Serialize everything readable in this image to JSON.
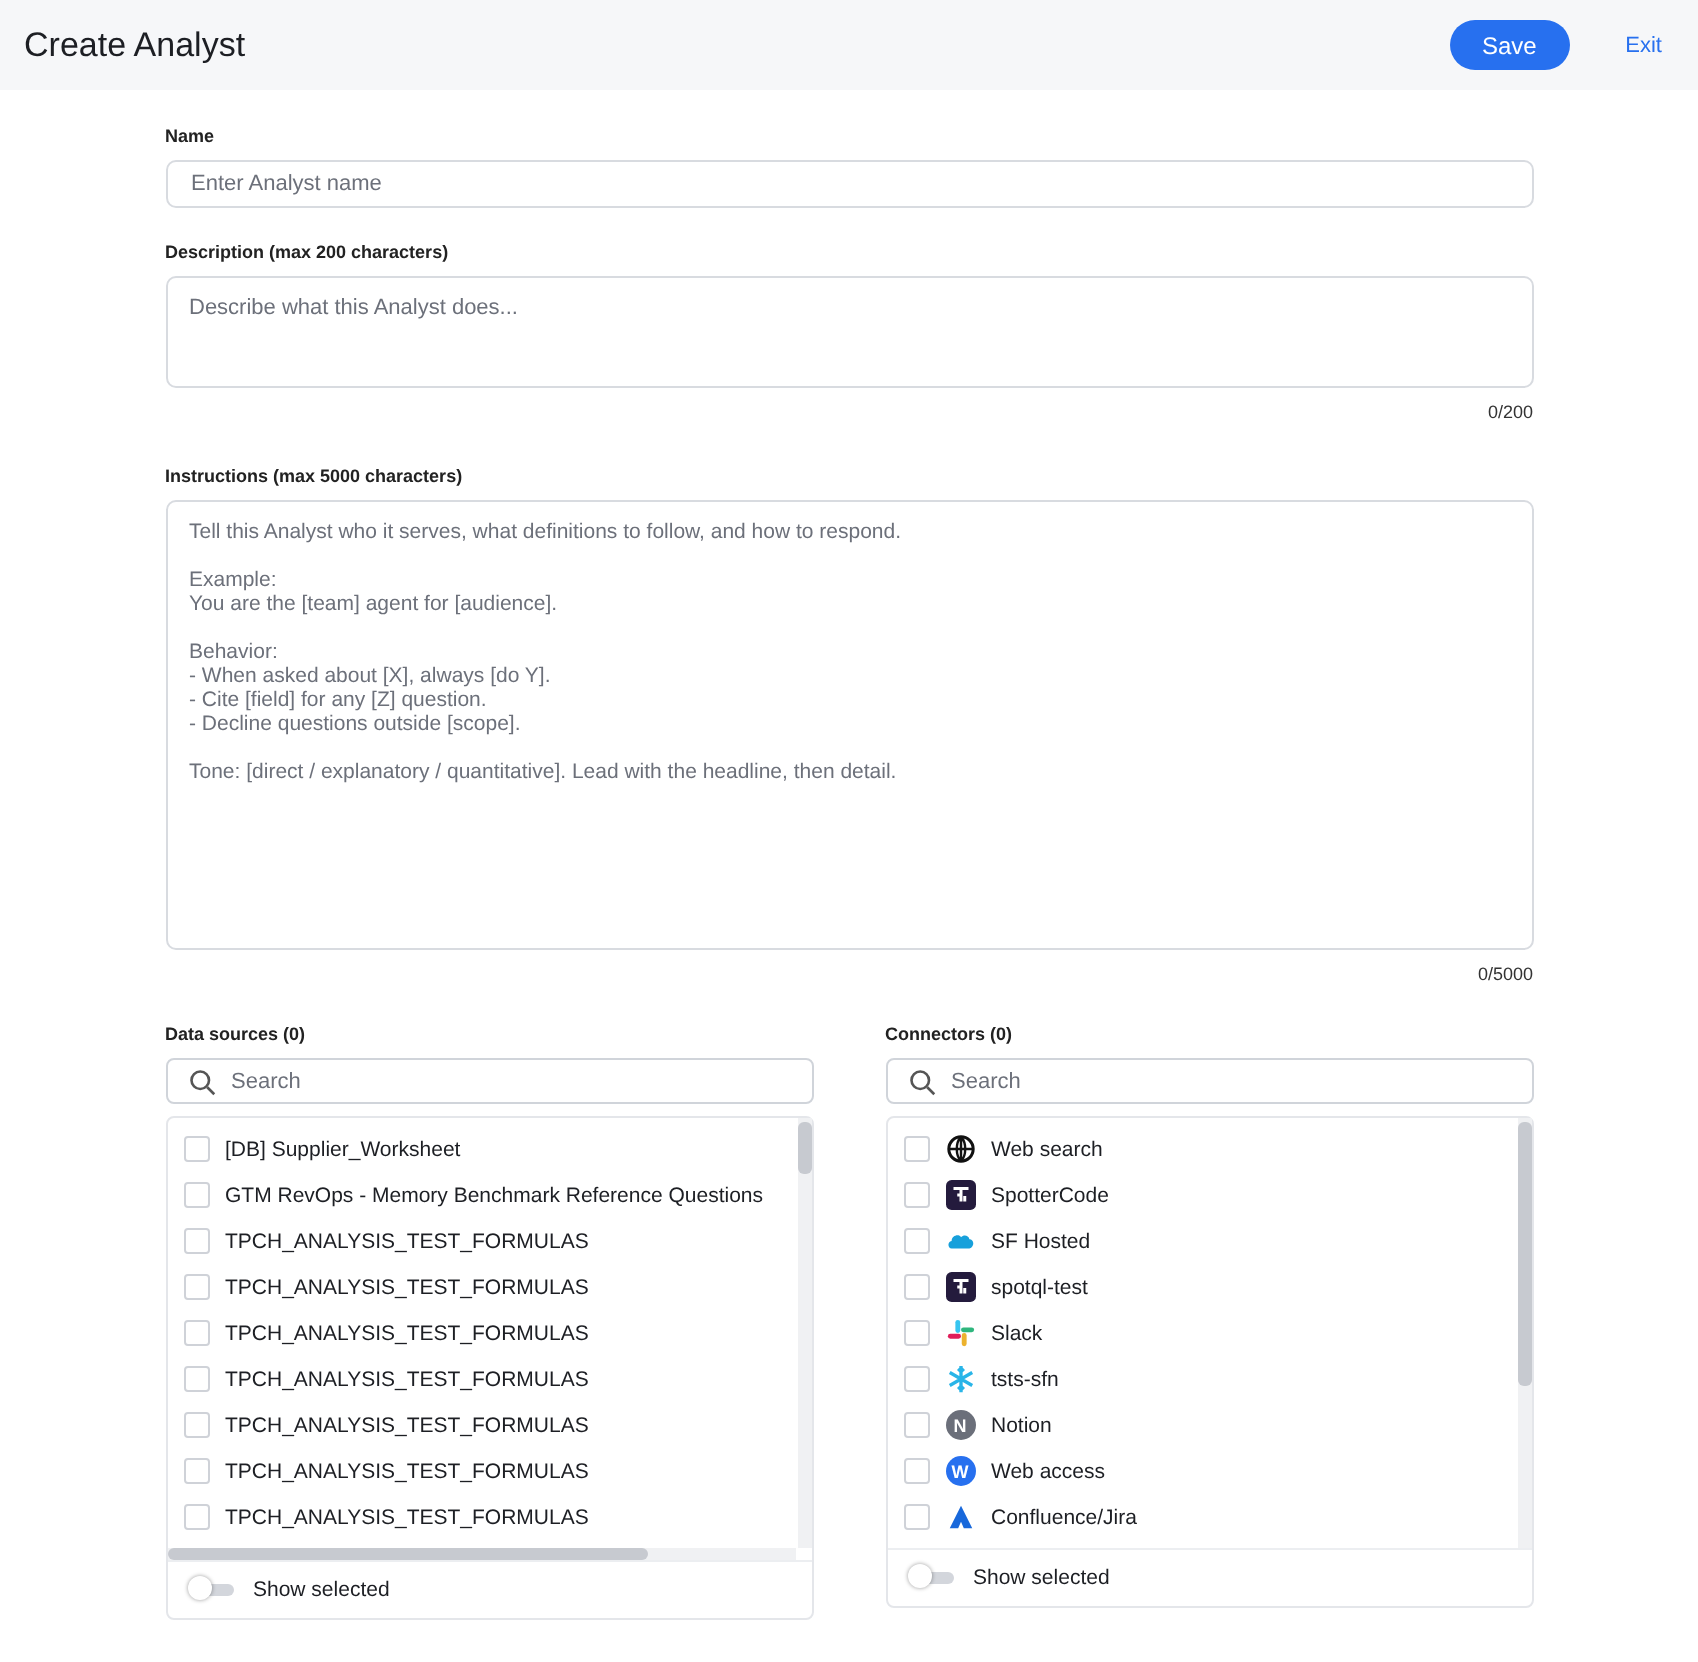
{
  "header": {
    "title": "Create Analyst",
    "save": "Save",
    "exit": "Exit"
  },
  "name": {
    "label": "Name",
    "placeholder": "Enter Analyst name"
  },
  "description": {
    "label": "Description (max 200 characters)",
    "placeholder": "Describe what this Analyst does...",
    "count": "0/200"
  },
  "instructions": {
    "label": "Instructions (max 5000 characters)",
    "placeholder": "Tell this Analyst who it serves, what definitions to follow, and how to respond.\n\nExample:\nYou are the [team] agent for [audience].\n\nBehavior:\n- When asked about [X], always [do Y].\n- Cite [field] for any [Z] question.\n- Decline questions outside [scope].\n\nTone: [direct / explanatory / quantitative]. Lead with the headline, then detail.",
    "count": "0/5000"
  },
  "data_sources": {
    "label": "Data sources (0)",
    "search_placeholder": "Search",
    "toggle_label": "Show selected",
    "toggle_on": false,
    "items": [
      {
        "label": "[DB] Supplier_Worksheet",
        "checked": false
      },
      {
        "label": "GTM RevOps - Memory Benchmark Reference Questions",
        "checked": false
      },
      {
        "label": "TPCH_ANALYSIS_TEST_FORMULAS",
        "checked": false
      },
      {
        "label": "TPCH_ANALYSIS_TEST_FORMULAS",
        "checked": false
      },
      {
        "label": "TPCH_ANALYSIS_TEST_FORMULAS",
        "checked": false
      },
      {
        "label": "TPCH_ANALYSIS_TEST_FORMULAS",
        "checked": false
      },
      {
        "label": "TPCH_ANALYSIS_TEST_FORMULAS",
        "checked": false
      },
      {
        "label": "TPCH_ANALYSIS_TEST_FORMULAS",
        "checked": false
      },
      {
        "label": "TPCH_ANALYSIS_TEST_FORMULAS",
        "checked": false
      }
    ]
  },
  "connectors": {
    "label": "Connectors (0)",
    "search_placeholder": "Search",
    "toggle_label": "Show selected",
    "toggle_on": false,
    "items": [
      {
        "label": "Web search",
        "checked": false,
        "kind": "globe"
      },
      {
        "label": "SpotterCode",
        "checked": false,
        "kind": "spotter"
      },
      {
        "label": "SF Hosted",
        "checked": false,
        "kind": "cloud"
      },
      {
        "label": "spotql-test",
        "checked": false,
        "kind": "spotter"
      },
      {
        "label": "Slack",
        "checked": false,
        "kind": "slack"
      },
      {
        "label": "tsts-sfn",
        "checked": false,
        "kind": "snowflake"
      },
      {
        "label": "Notion",
        "checked": false,
        "kind": "letter",
        "letter": "N",
        "color": "#6b6f7a"
      },
      {
        "label": "Web access",
        "checked": false,
        "kind": "letter",
        "letter": "W",
        "color": "#2770ef"
      },
      {
        "label": "Confluence/Jira",
        "checked": false,
        "kind": "confluence"
      }
    ]
  }
}
